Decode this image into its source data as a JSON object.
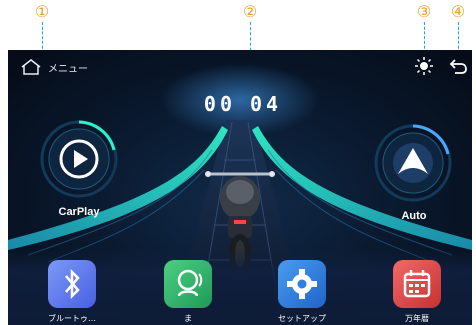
{
  "callouts": [
    {
      "label": "①"
    },
    {
      "label": "②"
    },
    {
      "label": "③"
    },
    {
      "label": "④"
    }
  ],
  "topbar": {
    "home_icon": "home-icon",
    "menu_label": "メニュー",
    "brightness_icon": "brightness-icon",
    "back_icon": "back-icon"
  },
  "clock": {
    "hours": "00",
    "minutes": "04"
  },
  "dials": {
    "left": {
      "label": "CarPlay",
      "icon": "play-icon"
    },
    "right": {
      "label": "Auto",
      "icon": "android-auto-icon"
    }
  },
  "dock": {
    "apps": [
      {
        "label": "ブルートゥ…",
        "icon": "bluetooth-icon",
        "color": "#5b7cf0"
      },
      {
        "label": "ま",
        "icon": "voice-assistant-icon",
        "color": "#35b36a"
      },
      {
        "label": "セットアップ",
        "icon": "gear-icon",
        "color": "#2f7fe0"
      },
      {
        "label": "万年暦",
        "icon": "calendar-icon",
        "color": "#e04848"
      }
    ]
  },
  "colors": {
    "accent": "#2ff0c8",
    "background": "#0a1a30",
    "callout": "#f0a020"
  }
}
